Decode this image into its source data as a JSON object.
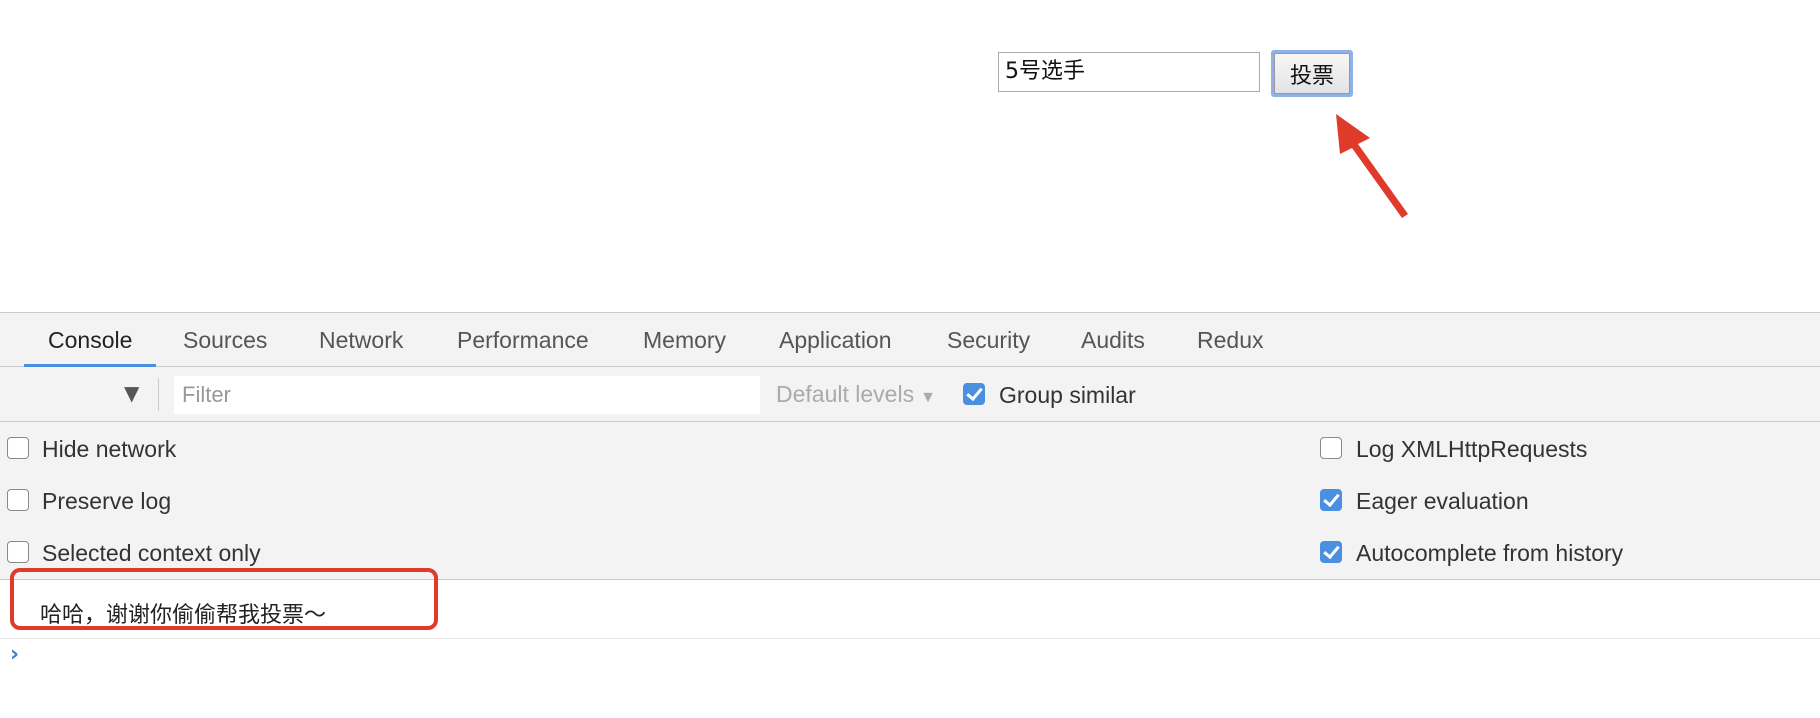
{
  "page": {
    "input_value": "5号选手",
    "button_label": "投票"
  },
  "devtools": {
    "tabs": [
      "Console",
      "Sources",
      "Network",
      "Performance",
      "Memory",
      "Application",
      "Security",
      "Audits",
      "Redux"
    ],
    "active_tab": "Console",
    "toolbar": {
      "filter_placeholder": "Filter",
      "levels_label": "Default levels",
      "group_similar_label": "Group similar",
      "group_similar_checked": true
    },
    "settings": {
      "left": [
        {
          "label": "Hide network",
          "checked": false
        },
        {
          "label": "Preserve log",
          "checked": false
        },
        {
          "label": "Selected context only",
          "checked": false
        }
      ],
      "right": [
        {
          "label": "Log XMLHttpRequests",
          "checked": false
        },
        {
          "label": "Eager evaluation",
          "checked": true
        },
        {
          "label": "Autocomplete from history",
          "checked": true
        }
      ]
    },
    "console": {
      "message": "哈哈，谢谢你偷偷帮我投票～",
      "prompt_symbol": "›"
    }
  },
  "colors": {
    "accent": "#4a8fe0",
    "annotation": "#e03a2a"
  },
  "icons": {
    "context_dropdown": "triangle-down-icon",
    "levels_caret": "caret-down-icon",
    "prompt": "chevron-right-icon",
    "annotation": "red-arrow-icon"
  }
}
